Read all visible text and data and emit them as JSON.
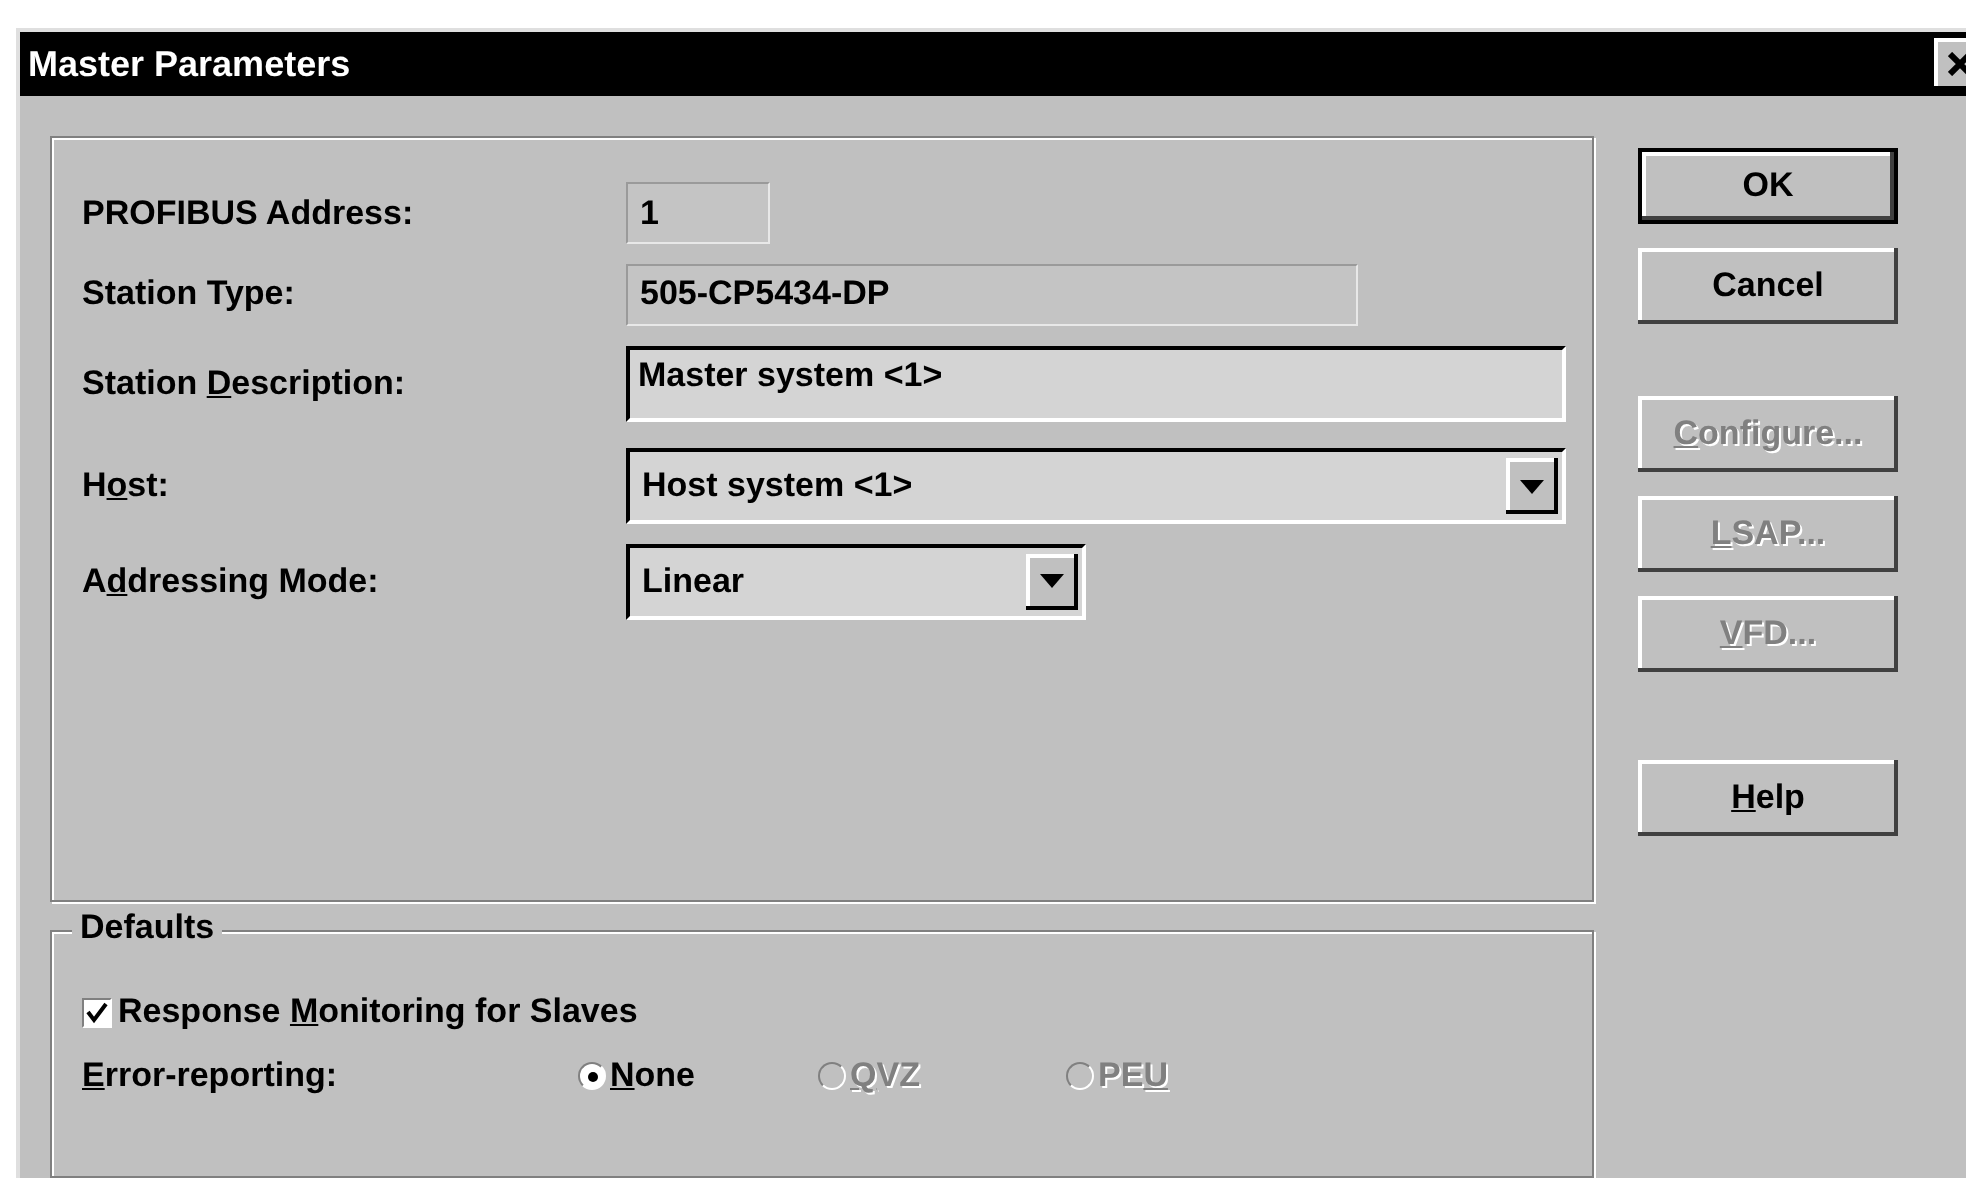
{
  "window": {
    "title": "Master Parameters"
  },
  "fields": [
    {
      "kind": "readonly",
      "label": {
        "pre": "PROFIBUS Address:"
      },
      "value": "1"
    },
    {
      "kind": "readonly",
      "label": {
        "pre": "Station Type:"
      },
      "value": "505-CP5434-DP"
    },
    {
      "kind": "edit",
      "label": {
        "pre": "Station ",
        "key": "D",
        "post": "escription:"
      },
      "value": "Master system <1>"
    },
    {
      "kind": "combo",
      "label": {
        "pre": "H",
        "key": "o",
        "post": "st:"
      },
      "value": "Host system <1>"
    },
    {
      "kind": "combo",
      "label": {
        "pre": "A",
        "key": "d",
        "post": "dressing Mode:"
      },
      "value": "Linear"
    }
  ],
  "buttons": [
    {
      "label": {
        "pre": "OK"
      },
      "default": true,
      "disabled": false
    },
    {
      "label": {
        "pre": "Cancel"
      },
      "default": false,
      "disabled": false
    },
    {
      "label": {
        "key": "C",
        "post": "onfigure..."
      },
      "default": false,
      "disabled": true
    },
    {
      "label": {
        "key": "L",
        "post": "SAP..."
      },
      "default": false,
      "disabled": true
    },
    {
      "label": {
        "key": "V",
        "post": "FD..."
      },
      "default": false,
      "disabled": true
    },
    {
      "label": {
        "key": "H",
        "post": "elp"
      },
      "default": false,
      "disabled": false
    }
  ],
  "defaults": {
    "title": "Defaults",
    "checkbox": {
      "label": {
        "pre": "Response ",
        "key": "M",
        "post": "onitoring for Slaves"
      },
      "checked": true
    },
    "error_reporting": {
      "label": {
        "key": "E",
        "post": "rror-reporting:"
      },
      "options": [
        {
          "label": {
            "key": "N",
            "post": "one"
          },
          "selected": true,
          "disabled": false
        },
        {
          "label": {
            "key": "Q",
            "post": "VZ"
          },
          "selected": false,
          "disabled": true
        },
        {
          "label": {
            "pre": "PE",
            "key": "U"
          },
          "selected": false,
          "disabled": true
        }
      ]
    }
  }
}
